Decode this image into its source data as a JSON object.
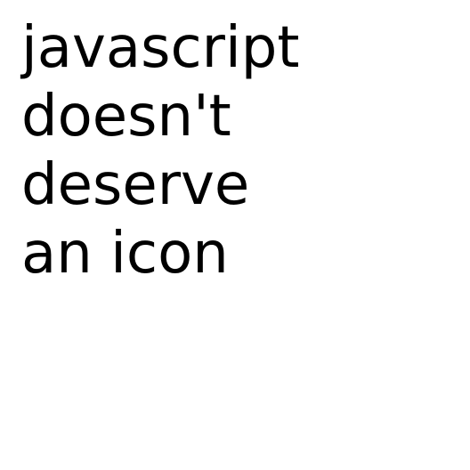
{
  "message": {
    "lines": [
      "javascript",
      "doesn't",
      "deserve",
      "an icon"
    ]
  },
  "colors": {
    "background": "#ffffff",
    "text": "#000000"
  }
}
